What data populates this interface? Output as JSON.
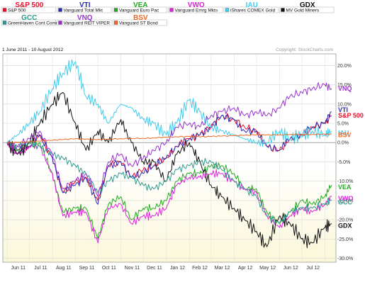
{
  "chart_data": {
    "type": "line",
    "date_range_label": "1 June 2011 - 10 August 2012",
    "copyright": "Copyright: StockCharts.com",
    "y_unit": "percent change",
    "ylim": [
      -31,
      23
    ],
    "y_ticks": [
      "20.0%",
      "15.0%",
      "10.0%",
      "5.0%",
      "0.0%",
      "-5.0%",
      "-10.0%",
      "-15.0%",
      "-20.0%",
      "-25.0%",
      "-30.0%"
    ],
    "y_tick_values": [
      20,
      15,
      10,
      5,
      0,
      -5,
      -10,
      -15,
      -20,
      -25,
      -30
    ],
    "x_ticks": [
      "Jun 11",
      "Jul 11",
      "Aug 11",
      "Sep 11",
      "Oct 11",
      "Nov 11",
      "Dec 11",
      "Jan 12",
      "Feb 12",
      "Mar 12",
      "Apr 12",
      "May 12",
      "Jun 12",
      "Jul 12"
    ],
    "x": [
      "2011-06-01",
      "2011-06-15",
      "2011-07-01",
      "2011-07-15",
      "2011-08-01",
      "2011-08-15",
      "2011-09-01",
      "2011-09-15",
      "2011-10-01",
      "2011-10-15",
      "2011-11-01",
      "2011-11-15",
      "2011-12-01",
      "2011-12-15",
      "2012-01-01",
      "2012-01-15",
      "2012-02-01",
      "2012-02-15",
      "2012-03-01",
      "2012-03-15",
      "2012-04-01",
      "2012-04-15",
      "2012-05-01",
      "2012-05-15",
      "2012-06-01",
      "2012-06-15",
      "2012-07-01",
      "2012-07-15",
      "2012-08-01",
      "2012-08-10"
    ],
    "grid": true,
    "legend_position": "top",
    "series": [
      {
        "ticker": "S&P 500",
        "name": "S&P 500",
        "color": "#e8102a",
        "end_label": "S&P 500",
        "end_value": 7.0,
        "values": [
          0,
          -2,
          -1,
          2,
          -4,
          -13,
          -10,
          -9,
          -15,
          -6,
          -5,
          -9,
          -7,
          -6,
          -4,
          -1,
          1,
          2,
          4,
          7,
          6,
          4,
          3,
          -1,
          -2,
          1,
          2,
          4,
          5,
          7
        ]
      },
      {
        "ticker": "VTI",
        "name": "Vanguard Total Mkt",
        "color": "#2a2ab8",
        "end_label": "VTI",
        "end_value": 8.5,
        "values": [
          0,
          -2,
          -1,
          2,
          -4,
          -13,
          -11,
          -9,
          -16,
          -6,
          -5,
          -9,
          -8,
          -6,
          -4,
          -1,
          1,
          2,
          4,
          7,
          6,
          3,
          3,
          -1,
          -2,
          1,
          2,
          4,
          5,
          8
        ]
      },
      {
        "ticker": "VEA",
        "name": "Vanguard Euro Pac",
        "color": "#22aa22",
        "end_label": "VEA",
        "end_value": -11.5,
        "values": [
          0,
          -2,
          -1,
          0,
          -8,
          -18,
          -17,
          -17,
          -25,
          -16,
          -14,
          -20,
          -17,
          -17,
          -15,
          -10,
          -8,
          -8,
          -6,
          -6,
          -8,
          -12,
          -12,
          -18,
          -21,
          -18,
          -15,
          -16,
          -14,
          -11
        ]
      },
      {
        "ticker": "VWO",
        "name": "Vanguard Emrg Mkts",
        "color": "#dd22dd",
        "end_label": "VWO",
        "end_value": -14.5,
        "values": [
          0,
          -3,
          -1,
          -1,
          -8,
          -19,
          -18,
          -18,
          -26,
          -17,
          -16,
          -21,
          -19,
          -19,
          -17,
          -11,
          -9,
          -9,
          -8,
          -8,
          -10,
          -12,
          -13,
          -19,
          -22,
          -19,
          -17,
          -18,
          -16,
          -14
        ]
      },
      {
        "ticker": "IAU",
        "name": "iShares COMEX Gold",
        "color": "#44ccee",
        "end_label": "IAU",
        "end_value": 2.5,
        "values": [
          0,
          2,
          5,
          8,
          14,
          18,
          21,
          12,
          10,
          5,
          10,
          9,
          6,
          5,
          2,
          5,
          11,
          8,
          4,
          3,
          2,
          1,
          0,
          0,
          3,
          1,
          2,
          3,
          2,
          3
        ]
      },
      {
        "ticker": "GDX",
        "name": "MV Gold Miners",
        "color": "#111111",
        "end_label": "GDX",
        "end_value": -21.5,
        "values": [
          0,
          -3,
          0,
          5,
          10,
          13,
          5,
          -2,
          3,
          0,
          6,
          0,
          -5,
          -5,
          -10,
          -3,
          0,
          -5,
          -11,
          -14,
          -17,
          -20,
          -23,
          -27,
          -19,
          -21,
          -25,
          -26,
          -22,
          -21
        ]
      },
      {
        "ticker": "GCC",
        "name": "GreenHaven Cont Comm",
        "color": "#2e9a8e",
        "end_label": "GCC",
        "end_value": -15.5,
        "values": [
          0,
          -1,
          0,
          -1,
          -3,
          -4,
          -6,
          -8,
          -13,
          -10,
          -8,
          -9,
          -11,
          -12,
          -10,
          -7,
          -6,
          -5,
          -5,
          -7,
          -10,
          -12,
          -14,
          -19,
          -21,
          -18,
          -17,
          -17,
          -16,
          -15
        ]
      },
      {
        "ticker": "VNQ",
        "name": "Vanguard REIT VIPER",
        "color": "#9933cc",
        "end_label": "VNQ",
        "end_value": 14.0,
        "values": [
          0,
          -1,
          1,
          3,
          -3,
          -12,
          -10,
          -8,
          -14,
          -5,
          -3,
          -6,
          -4,
          -2,
          0,
          4,
          5,
          4,
          7,
          8,
          9,
          7,
          8,
          7,
          9,
          12,
          13,
          14,
          15,
          14
        ]
      },
      {
        "ticker": "BSV",
        "name": "Vanguard ST Bond",
        "color": "#ee6622",
        "end_label": "BSV",
        "end_value": 2.0,
        "values": [
          0,
          0.1,
          0.2,
          0.4,
          0.6,
          0.8,
          1.0,
          0.9,
          0.8,
          0.9,
          1.0,
          1.1,
          1.1,
          1.2,
          1.4,
          1.5,
          1.6,
          1.5,
          1.6,
          1.7,
          1.8,
          1.9,
          2.0,
          2.0,
          2.0,
          2.1,
          2.1,
          2.1,
          2.2,
          2.2
        ]
      }
    ]
  }
}
